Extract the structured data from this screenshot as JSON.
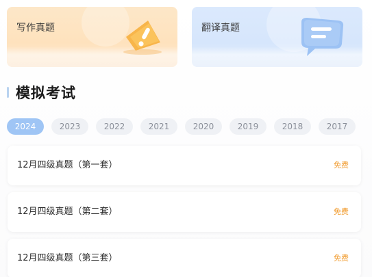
{
  "cards": {
    "writing": {
      "label": "写作真题",
      "icon": "alert-flag-icon"
    },
    "translate": {
      "label": "翻译真题",
      "icon": "chat-bubble-icon"
    }
  },
  "section": {
    "title": "模拟考试"
  },
  "years": [
    "2024",
    "2023",
    "2022",
    "2021",
    "2020",
    "2019",
    "2018",
    "2017"
  ],
  "selected_year": "2024",
  "exams": [
    {
      "title": "12月四级真题（第一套）",
      "badge": "免费"
    },
    {
      "title": "12月四级真题（第二套）",
      "badge": "免费"
    },
    {
      "title": "12月四级真题（第三套）",
      "badge": "免费"
    }
  ],
  "colors": {
    "accent_active_year": "#9fc5f5",
    "free_badge": "#f19a2b",
    "writing_card": "#fde7c8",
    "translate_card": "#dbe9fd"
  }
}
